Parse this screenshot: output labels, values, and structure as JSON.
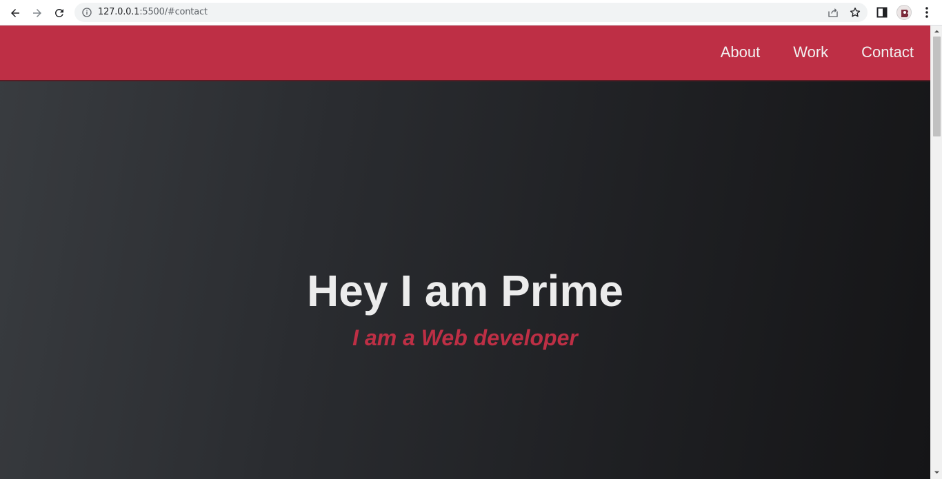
{
  "browser": {
    "url_host": "127.0.0.1",
    "url_rest": ":5500/#contact",
    "icons": [
      "back-arrow-icon",
      "forward-arrow-icon",
      "reload-icon",
      "info-icon",
      "share-icon",
      "star-icon",
      "side-panel-icon",
      "profile-avatar",
      "menu-dots-icon"
    ]
  },
  "site": {
    "nav": [
      {
        "label": "About"
      },
      {
        "label": "Work"
      },
      {
        "label": "Contact"
      }
    ],
    "hero": {
      "title": "Hey I am Prime",
      "subtitle": "I am a Web developer"
    },
    "colors": {
      "accent": "#be2f45",
      "background_dark": "#1e1f22",
      "text_light": "#ececec"
    }
  }
}
